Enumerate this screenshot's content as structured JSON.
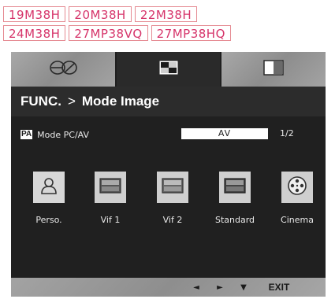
{
  "models": {
    "row1": [
      "19M38H",
      "20M38H",
      "22M38H"
    ],
    "row2": [
      "24M38H",
      "27MP38VQ",
      "27MP38HQ"
    ]
  },
  "osd": {
    "tabs": [
      {
        "icon": "eco-icon",
        "active": false
      },
      {
        "icon": "picture-mode-icon",
        "active": true
      },
      {
        "icon": "display-icon",
        "active": false
      }
    ],
    "breadcrumb": {
      "parent": "FUNC.",
      "separator": ">",
      "current": "Mode Image"
    },
    "mode_row": {
      "icon_text": "PA",
      "label": "Mode PC/AV",
      "value": "AV",
      "page": "1/2"
    },
    "modes": [
      {
        "label": "Perso.",
        "icon": "person-icon"
      },
      {
        "label": "Vif 1",
        "icon": "vivid1-icon"
      },
      {
        "label": "Vif 2",
        "icon": "vivid2-icon"
      },
      {
        "label": "Standard",
        "icon": "standard-icon"
      },
      {
        "label": "Cinema",
        "icon": "film-reel-icon"
      }
    ],
    "footer": {
      "left": "◄",
      "right": "►",
      "down": "▼",
      "exit": "EXIT"
    }
  },
  "colors": {
    "tag_border": "#e58a92",
    "tag_text": "#d6346a",
    "osd_bg": "#1f1f1f"
  }
}
